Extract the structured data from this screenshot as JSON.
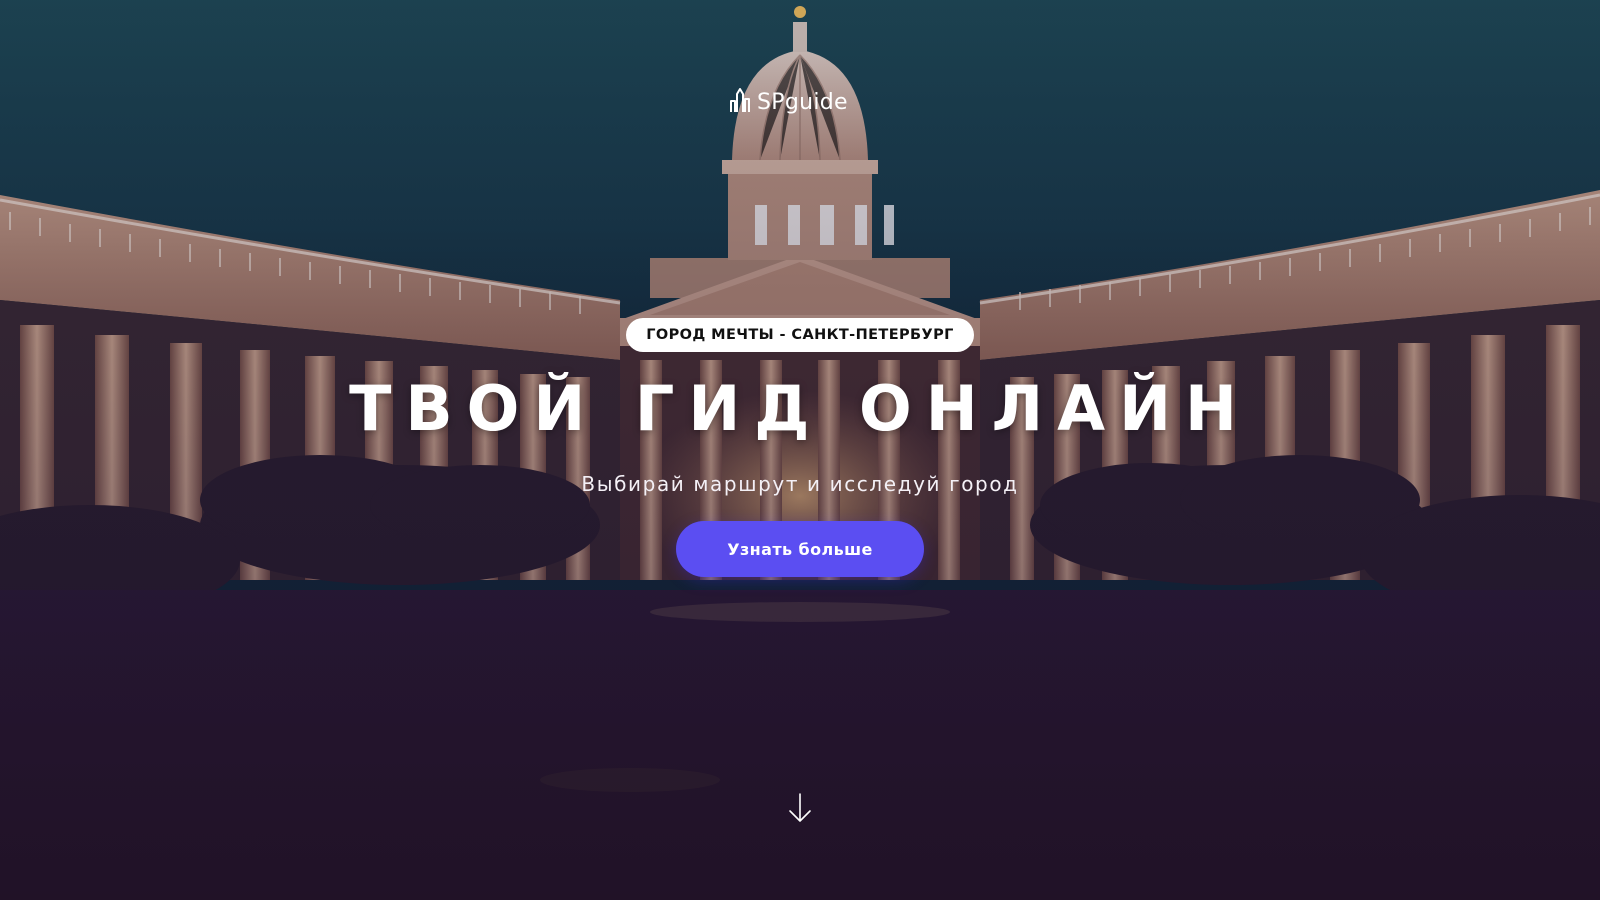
{
  "brand": {
    "logo_text": "SPguide",
    "logo_icon": "city-skyline-icon"
  },
  "hero": {
    "badge": "ГОРОД МЕЧТЫ - САНКТ-ПЕТЕРБУРГ",
    "title": "ТВОЙ ГИД ОНЛАЙН",
    "subtitle": "Выбирай маршрут и исследуй город",
    "cta_label": "Узнать больше",
    "scroll_icon": "arrow-down-icon",
    "background": "Kazan Cathedral colonnade at night"
  },
  "colors": {
    "accent": "#5b4ef2",
    "sky": "#1c4452",
    "overlay": "#2a1838",
    "badge_bg": "#ffffff"
  }
}
